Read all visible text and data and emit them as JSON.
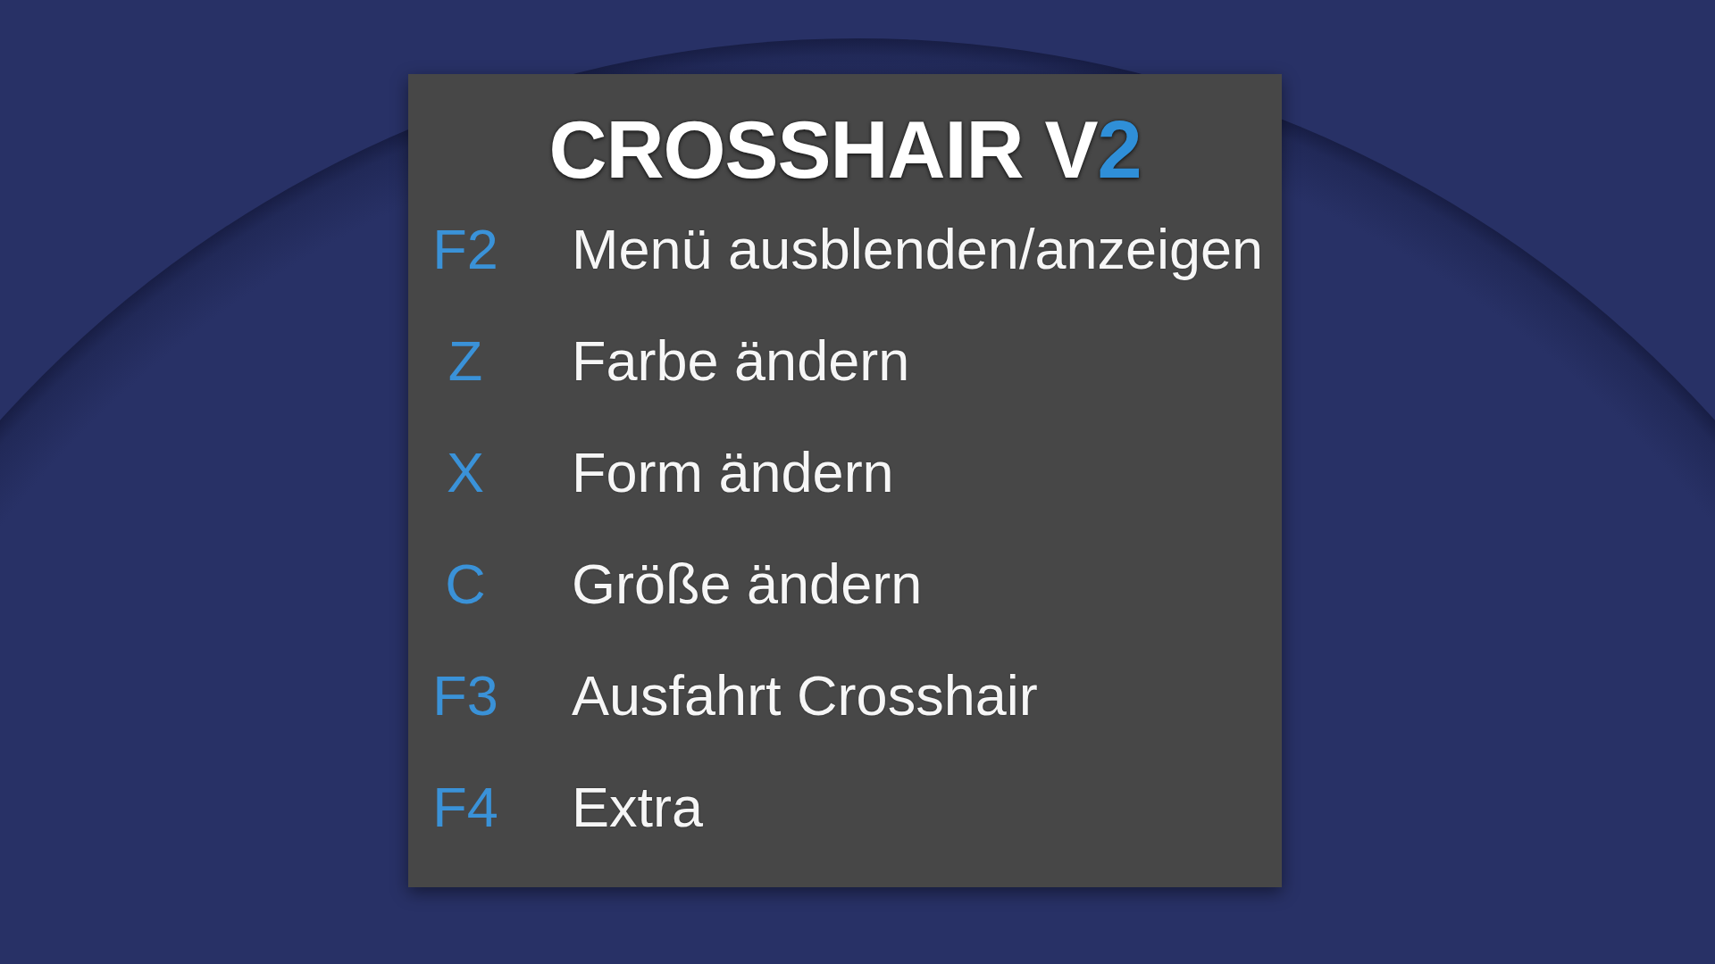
{
  "title": {
    "text": "CROSSHAIR V",
    "accent": "2"
  },
  "shortcuts": [
    {
      "key": "F2",
      "action": "Menü ausblenden/anzeigen"
    },
    {
      "key": "Z",
      "action": "Farbe ändern"
    },
    {
      "key": "X",
      "action": "Form ändern"
    },
    {
      "key": "C",
      "action": "Größe ändern"
    },
    {
      "key": "F3",
      "action": "Ausfahrt Crosshair"
    },
    {
      "key": "F4",
      "action": "Extra"
    }
  ]
}
